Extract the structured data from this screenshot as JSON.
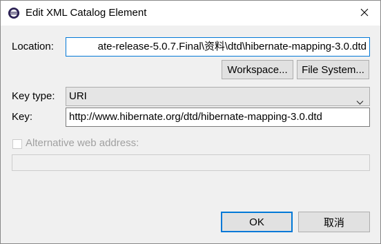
{
  "window": {
    "title": "Edit XML Catalog Element",
    "app_icon": "eclipse-icon",
    "close_icon": "close-icon"
  },
  "location": {
    "label": "Location:",
    "value": "ate-release-5.0.7.Final\\资料\\dtd\\hibernate-mapping-3.0.dtd"
  },
  "buttons": {
    "workspace": "Workspace...",
    "file_system": "File System...",
    "ok": "OK",
    "cancel": "取消"
  },
  "key_type": {
    "label": "Key type:",
    "selected": "URI",
    "icon": "chevron-down-icon"
  },
  "key": {
    "label": "Key:",
    "value": "http://www.hibernate.org/dtd/hibernate-mapping-3.0.dtd"
  },
  "alternative": {
    "label": "Alternative web address:",
    "checked": false,
    "value": ""
  },
  "colors": {
    "accent": "#0078d7",
    "background": "#f0f0f0"
  }
}
